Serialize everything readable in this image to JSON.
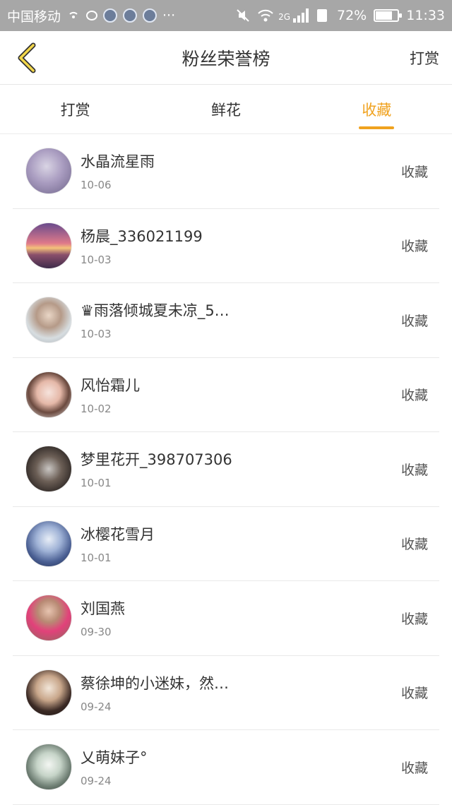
{
  "status_bar": {
    "carrier": "中国移动",
    "battery": "72%",
    "battery_level": 0.72,
    "network": "2G",
    "time": "11:33"
  },
  "header": {
    "title": "粉丝荣誉榜",
    "right": "打赏"
  },
  "tabs": [
    {
      "label": "打赏",
      "active": false
    },
    {
      "label": "鲜花",
      "active": false
    },
    {
      "label": "收藏",
      "active": true
    }
  ],
  "colors": {
    "accent": "#f0a21f"
  },
  "list": [
    {
      "name": "水晶流星雨",
      "date": "10-06",
      "action": "收藏"
    },
    {
      "name": "杨晨_336021199",
      "date": "10-03",
      "action": "收藏"
    },
    {
      "name": "♛雨落倾城夏未凉_5…",
      "date": "10-03",
      "action": "收藏"
    },
    {
      "name": "风怡霜儿",
      "date": "10-02",
      "action": "收藏"
    },
    {
      "name": "梦里花开_398707306",
      "date": "10-01",
      "action": "收藏"
    },
    {
      "name": "冰樱花雪月",
      "date": "10-01",
      "action": "收藏"
    },
    {
      "name": "刘国燕",
      "date": "09-30",
      "action": "收藏"
    },
    {
      "name": "蔡徐坤的小迷妹，然…",
      "date": "09-24",
      "action": "收藏"
    },
    {
      "name": "乂萌妹子°",
      "date": "09-24",
      "action": "收藏"
    }
  ]
}
